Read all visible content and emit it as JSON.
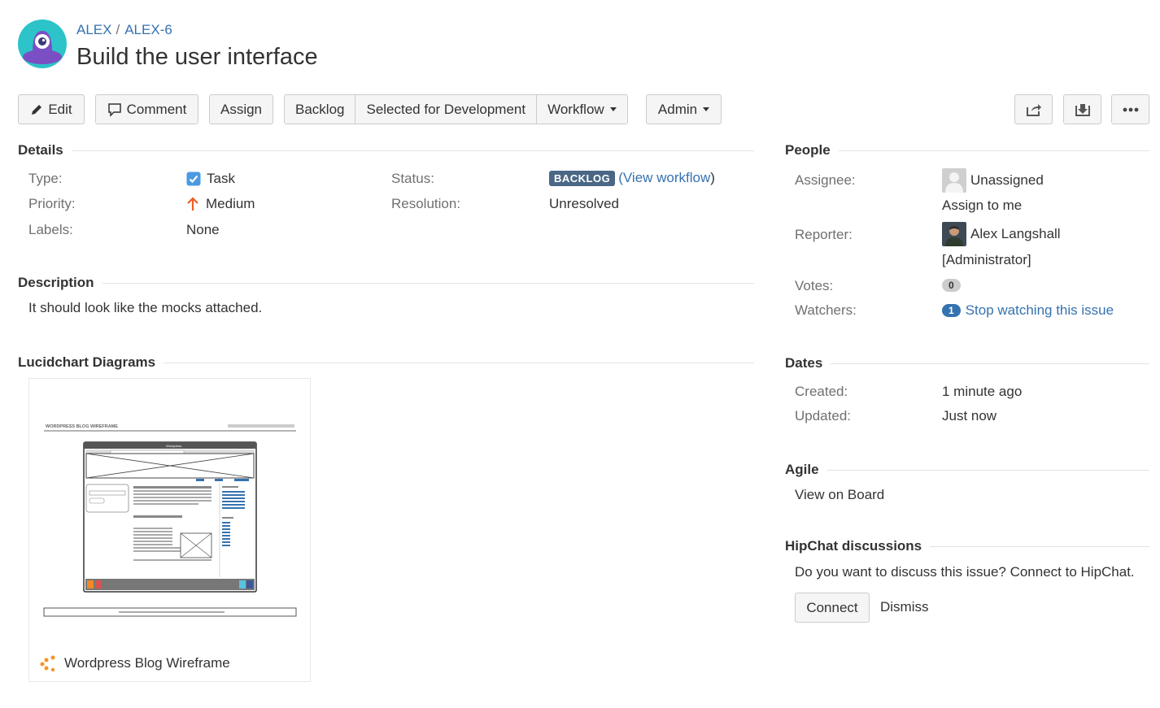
{
  "header": {
    "project_key": "ALEX",
    "issue_key": "ALEX-6",
    "separator": "/",
    "title": "Build the user interface"
  },
  "toolbar": {
    "edit": "Edit",
    "comment": "Comment",
    "assign": "Assign",
    "backlog": "Backlog",
    "selected_for_development": "Selected for Development",
    "workflow": "Workflow",
    "admin": "Admin"
  },
  "details": {
    "heading": "Details",
    "type_label": "Type:",
    "type_value": "Task",
    "priority_label": "Priority:",
    "priority_value": "Medium",
    "labels_label": "Labels:",
    "labels_value": "None",
    "status_label": "Status:",
    "status_value": "BACKLOG",
    "view_workflow": "View workflow",
    "resolution_label": "Resolution:",
    "resolution_value": "Unresolved"
  },
  "description": {
    "heading": "Description",
    "text": "It should look like the mocks attached."
  },
  "lucidchart": {
    "heading": "Lucidchart Diagrams",
    "diagram_name": "Wordpress Blog Wireframe",
    "thumb_title": "WORDPRESS BLOG WIREFRAME",
    "thumb_window_title": "Wordpress"
  },
  "people": {
    "heading": "People",
    "assignee_label": "Assignee:",
    "assignee_value": "Unassigned",
    "assign_to_me": "Assign to me",
    "reporter_label": "Reporter:",
    "reporter_value": "Alex Langshall",
    "reporter_role": "[Administrator]",
    "votes_label": "Votes:",
    "votes_count": "0",
    "watchers_label": "Watchers:",
    "watchers_count": "1",
    "stop_watching": "Stop watching this issue"
  },
  "dates": {
    "heading": "Dates",
    "created_label": "Created:",
    "created_value": "1 minute ago",
    "updated_label": "Updated:",
    "updated_value": "Just now"
  },
  "agile": {
    "heading": "Agile",
    "view_on_board": "View on Board"
  },
  "hipchat": {
    "heading": "HipChat discussions",
    "prompt": "Do you want to discuss this issue? Connect to HipChat.",
    "connect": "Connect",
    "dismiss": "Dismiss"
  },
  "colors": {
    "link": "#3572b0",
    "status_lozenge": "#4a6785",
    "priority_arrow": "#f15c28",
    "task_icon": "#4a9ae1"
  },
  "icons": [
    "project-avatar-icon",
    "pencil-icon",
    "comment-icon",
    "share-icon",
    "export-icon",
    "more-icon",
    "task-icon",
    "priority-medium-icon",
    "unassigned-avatar-icon",
    "reporter-avatar-icon",
    "lucidchart-icon"
  ]
}
